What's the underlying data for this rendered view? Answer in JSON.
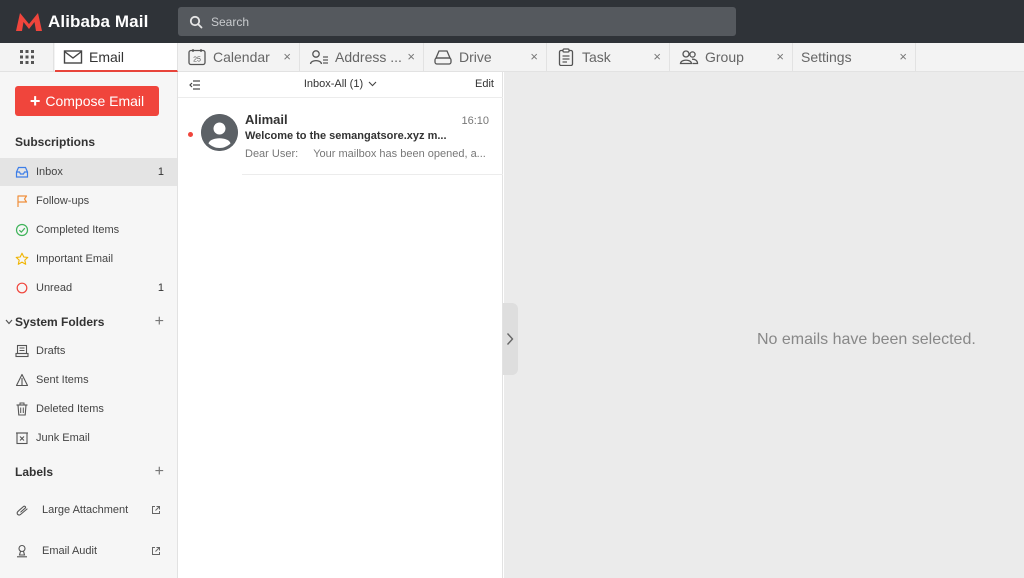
{
  "app": {
    "title": "Alibaba Mail"
  },
  "colors": {
    "brand_red": "#f0453c",
    "topbar": "#2f3338",
    "sidebar_bg": "#f6f6f6",
    "reading_bg": "#ebebeb"
  },
  "search": {
    "placeholder": "Search",
    "icon": "search-icon"
  },
  "apps_menu": {
    "icon": "grid-icon"
  },
  "tabs": [
    {
      "label": "Email",
      "icon": "envelope-icon",
      "active": true,
      "closable": false
    },
    {
      "label": "Calendar",
      "icon": "calendar-icon",
      "icon_text": "25",
      "closable": true,
      "close": "×"
    },
    {
      "label": "Address ...",
      "icon": "contacts-icon",
      "closable": true,
      "close": "×"
    },
    {
      "label": "Drive",
      "icon": "drive-icon",
      "closable": true,
      "close": "×"
    },
    {
      "label": "Task",
      "icon": "clipboard-icon",
      "closable": true,
      "close": "×"
    },
    {
      "label": "Group",
      "icon": "group-icon",
      "closable": true,
      "close": "×"
    },
    {
      "label": "Settings",
      "closable": true,
      "close": "×"
    }
  ],
  "sidebar": {
    "compose": {
      "plus": "+",
      "label": "Compose Email"
    },
    "subscriptions": {
      "heading": "Subscriptions",
      "items": [
        {
          "label": "Inbox",
          "icon": "inbox-icon",
          "count": "1",
          "selected": true
        },
        {
          "label": "Follow-ups",
          "icon": "flag-icon",
          "count": ""
        },
        {
          "label": "Completed Items",
          "icon": "check-circle-icon",
          "count": ""
        },
        {
          "label": "Important Email",
          "icon": "star-icon",
          "count": ""
        },
        {
          "label": "Unread",
          "icon": "circle-icon",
          "count": "1"
        }
      ]
    },
    "system_folders": {
      "heading": "System Folders",
      "add": "+",
      "items": [
        {
          "label": "Drafts",
          "icon": "drafts-icon"
        },
        {
          "label": "Sent Items",
          "icon": "sent-icon"
        },
        {
          "label": "Deleted Items",
          "icon": "trash-icon"
        },
        {
          "label": "Junk Email",
          "icon": "junk-icon"
        }
      ]
    },
    "labels": {
      "heading": "Labels",
      "add": "+",
      "items": [
        {
          "label": "Large Attachment",
          "icon": "paperclip-icon"
        },
        {
          "label": "Email Audit",
          "icon": "audit-icon"
        }
      ]
    }
  },
  "list": {
    "folder": "Inbox-All",
    "folder_count": "(1)",
    "edit": "Edit",
    "messages": [
      {
        "sender": "Alimail",
        "time": "16:10",
        "subject": "Welcome to the semangatsore.xyz m...",
        "preview_greeting": "Dear User:",
        "preview_body": "Your mailbox has been opened, a...",
        "unread": true
      }
    ]
  },
  "reading": {
    "empty_text": "No emails have been selected."
  }
}
